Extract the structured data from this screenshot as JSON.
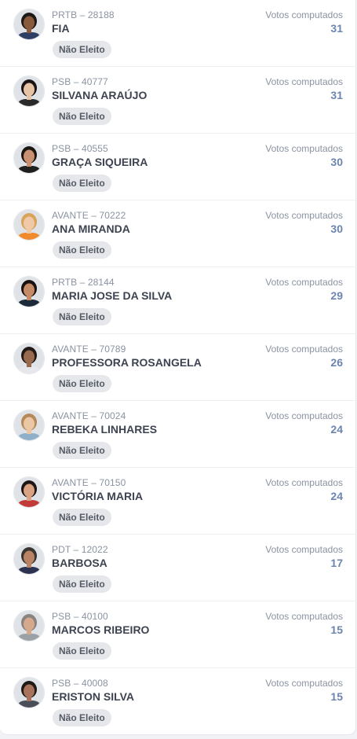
{
  "votes_label": "Votos computados",
  "status_label": "Não Eleito",
  "candidates": [
    {
      "party": "PRTB – 28188",
      "name": "FIA",
      "votes": "31",
      "skin": "#8a5a3c",
      "hair": "#1e1a18",
      "shirt": "#2e3f66"
    },
    {
      "party": "PSB – 40777",
      "name": "SILVANA ARAÚJO",
      "votes": "31",
      "skin": "#e7c3a6",
      "hair": "#1a1414",
      "shirt": "#2a2a2a"
    },
    {
      "party": "PSB – 40555",
      "name": "GRAÇA SIQUEIRA",
      "votes": "30",
      "skin": "#c99072",
      "hair": "#1c1612",
      "shirt": "#1f1f1f"
    },
    {
      "party": "AVANTE – 70222",
      "name": "ANA MIRANDA",
      "votes": "30",
      "skin": "#efc9a8",
      "hair": "#d9a35a",
      "shirt": "#f08a2c"
    },
    {
      "party": "PRTB – 28144",
      "name": "MARIA JOSE DA SILVA",
      "votes": "29",
      "skin": "#c58a66",
      "hair": "#1a1210",
      "shirt": "#1c2a3a"
    },
    {
      "party": "AVANTE – 70789",
      "name": "PROFESSORA ROSANGELA",
      "votes": "26",
      "skin": "#9a6a4e",
      "hair": "#221a16",
      "shirt": "#e8e8ec"
    },
    {
      "party": "AVANTE – 70024",
      "name": "REBEKA LINHARES",
      "votes": "24",
      "skin": "#ecc7a6",
      "hair": "#b58a58",
      "shirt": "#8fb0c8"
    },
    {
      "party": "AVANTE – 70150",
      "name": "VICTÓRIA MARIA",
      "votes": "24",
      "skin": "#d9a283",
      "hair": "#1e1614",
      "shirt": "#c23a3a"
    },
    {
      "party": "PDT – 12022",
      "name": "BARBOSA",
      "votes": "17",
      "skin": "#b98364",
      "hair": "#3a3532",
      "shirt": "#2b3350"
    },
    {
      "party": "PSB – 40100",
      "name": "MARCOS RIBEIRO",
      "votes": "15",
      "skin": "#d6a98d",
      "hair": "#8a8480",
      "shirt": "#9aa2a8"
    },
    {
      "party": "PSB – 40008",
      "name": "ERISTON SILVA",
      "votes": "15",
      "skin": "#a8735a",
      "hair": "#201a16",
      "shirt": "#4a4e58"
    }
  ]
}
